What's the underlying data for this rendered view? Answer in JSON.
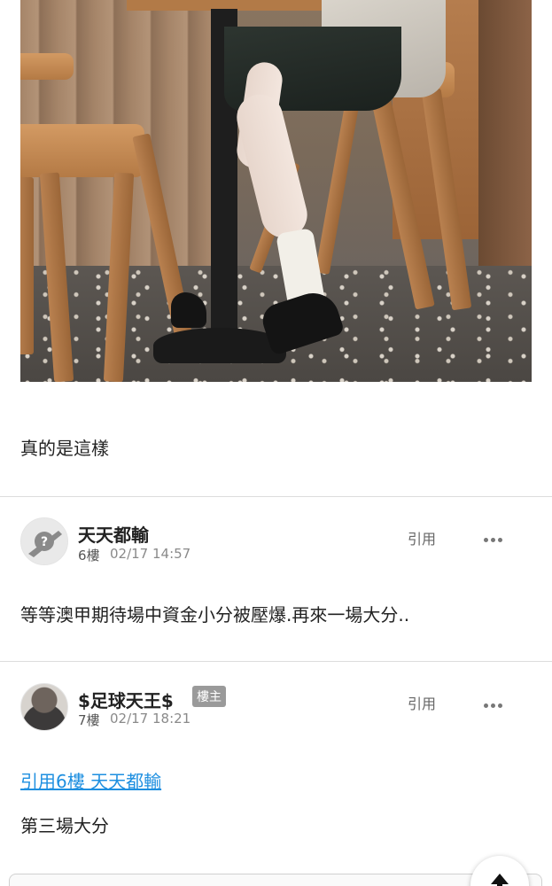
{
  "post_image": {
    "alt": ""
  },
  "post_body": {
    "text": "真的是這樣"
  },
  "replies": [
    {
      "username": "天天都輸",
      "floor": "6樓",
      "time": "02/17 14:57",
      "quote_label": "引用",
      "body": "等等澳甲期待場中資金小分被壓爆.再來一場大分.."
    },
    {
      "username": "$足球天王$",
      "badge": "樓主",
      "floor": "7樓",
      "time": "02/17 18:21",
      "quote_label": "引用",
      "quote_ref": "引用6樓 天天都輸",
      "body": "第三場大分"
    }
  ],
  "icons": {
    "more": "more-horizontal-icon",
    "scroll_top": "arrow-up-icon"
  },
  "colors": {
    "link": "#1e8fe0",
    "badge_bg": "#9a9a9a",
    "divider": "#dcdcdc"
  }
}
